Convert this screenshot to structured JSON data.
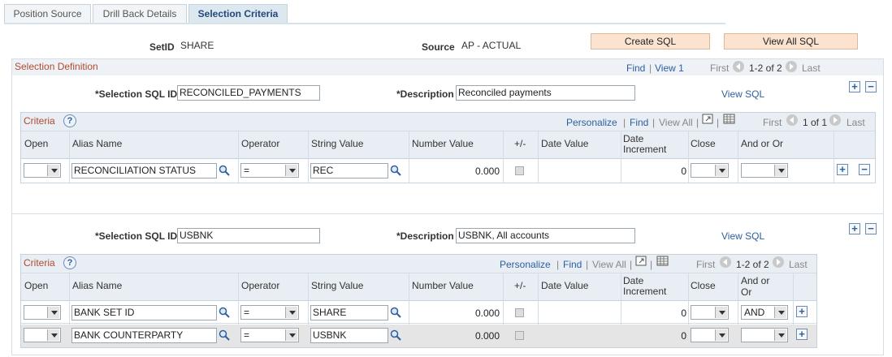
{
  "tabs": [
    {
      "label": "Position Source"
    },
    {
      "label": "Drill Back Details"
    },
    {
      "label": "Selection Criteria"
    }
  ],
  "header": {
    "setid_label": "SetID",
    "setid_value": "SHARE",
    "source_label": "Source",
    "source_value": "AP - ACTUAL",
    "create_sql": "Create SQL",
    "view_all_sql": "View All SQL"
  },
  "definition": {
    "title": "Selection Definition",
    "find": "Find",
    "sep": "|",
    "view1": "View 1",
    "first": "First",
    "count": "1-2 of 2",
    "last": "Last"
  },
  "common": {
    "sql_id_label": "*Selection SQL ID",
    "desc_label": "*Description",
    "view_sql": "View SQL",
    "criteria": "Criteria",
    "help": "?",
    "personalize": "Personalize",
    "find": "Find",
    "view_all": "View All",
    "first": "First",
    "last": "Last",
    "sep": "|",
    "plus": "+",
    "minus": "−"
  },
  "columns": {
    "open": "Open",
    "alias": "Alias Name",
    "operator": "Operator",
    "string": "String Value",
    "number": "Number Value",
    "pm": "+/-",
    "date": "Date Value",
    "dateinc": "Date Increment",
    "close": "Close",
    "andor": "And or Or",
    "andor2a": "And or",
    "andor2b": "Or"
  },
  "block1": {
    "sql_id": "RECONCILED_PAYMENTS",
    "description": "Reconciled payments",
    "count": "1 of 1",
    "rows": [
      {
        "alias": "RECONCILIATION STATUS",
        "operator": "=",
        "string": "REC",
        "number": "0.000",
        "dateinc": "0",
        "andor": ""
      }
    ]
  },
  "block2": {
    "sql_id": "USBNK",
    "description": "USBNK, All accounts",
    "count": "1-2 of 2",
    "rows": [
      {
        "alias": "BANK SET ID",
        "operator": "=",
        "string": "SHARE",
        "number": "0.000",
        "dateinc": "0",
        "andor": "AND"
      },
      {
        "alias": "BANK COUNTERPARTY",
        "operator": "=",
        "string": "USBNK",
        "number": "0.000",
        "dateinc": "0",
        "andor": ""
      }
    ]
  }
}
